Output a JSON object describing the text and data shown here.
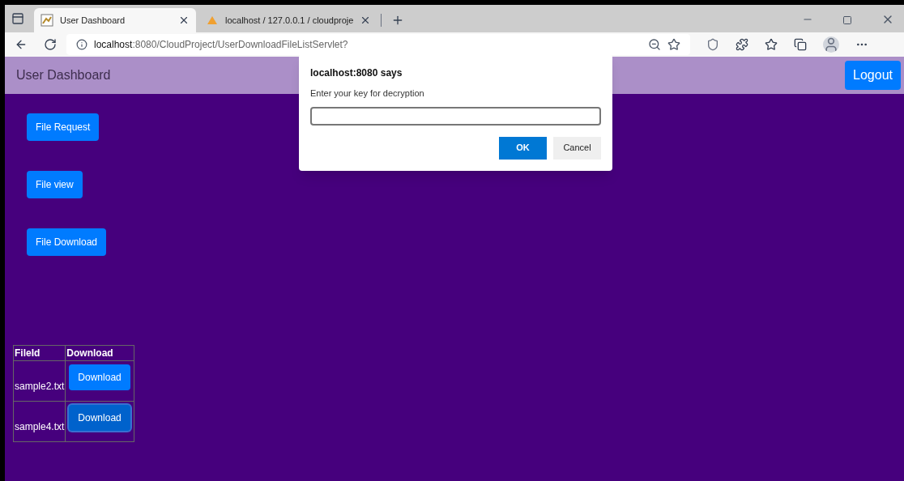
{
  "browser": {
    "tabs": [
      {
        "title": "User Dashboard",
        "selected": true,
        "kind": "app"
      },
      {
        "title": "localhost / 127.0.0.1 / cloudproje",
        "selected": false,
        "kind": "pma"
      }
    ],
    "address": {
      "host": "localhost",
      "rest": ":8080/CloudProject/UserDownloadFileListServlet?"
    }
  },
  "navbar": {
    "title": "User Dashboard",
    "logout": "Logout"
  },
  "menu": [
    "File Request",
    "File view",
    "File Download"
  ],
  "table": {
    "columns": [
      "FileId",
      "Download"
    ],
    "rows": [
      {
        "file": "sample2.txt",
        "action": "Download",
        "focused": false
      },
      {
        "file": "sample4.txt",
        "action": "Download",
        "focused": true
      }
    ]
  },
  "dialog": {
    "title": "localhost:8080 says",
    "message": "Enter your key for decryption",
    "ok": "OK",
    "cancel": "Cancel"
  }
}
